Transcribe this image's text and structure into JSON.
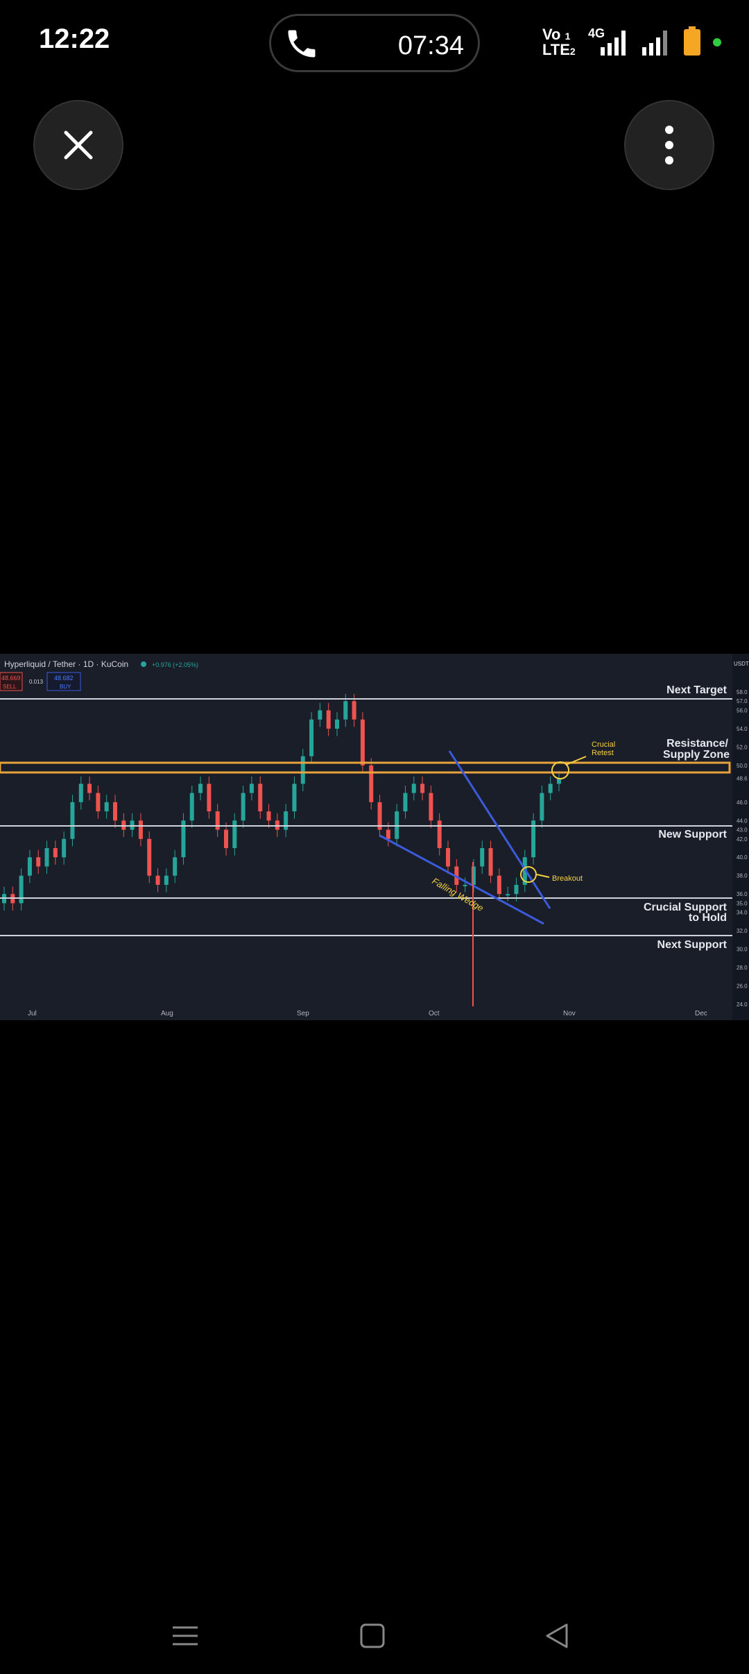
{
  "status_bar": {
    "time": "12:22",
    "call_timer": "07:34",
    "network_line1": "Vo",
    "network_line2": "LTE",
    "sim1": "1",
    "sim2": "2",
    "data_type": "4G"
  },
  "overlay": {
    "close_icon": "close-icon",
    "menu_icon": "more-vertical-icon"
  },
  "chart": {
    "header": "Hyperliquid / Tether · 1D · KuCoin",
    "change": "+0.976 (+2.05%)",
    "sell_price": "48.669",
    "sell_label": "SELL",
    "spread": "0.013",
    "buy_price": "48.682",
    "buy_label": "BUY",
    "currency": "USDT",
    "annotations": {
      "next_target": "Next Target",
      "resistance_line1": "Resistance/",
      "resistance_line2": "Supply Zone",
      "crucial_retest_line1": "Crucial",
      "crucial_retest_line2": "Retest",
      "new_support": "New Support",
      "breakout": "Breakout",
      "falling_wedge": "Falling Wedge",
      "crucial_support_line1": "Crucial Support",
      "crucial_support_line2": "to Hold",
      "next_support": "Next Support"
    },
    "x_labels": [
      "Jul",
      "Aug",
      "Sep",
      "Oct",
      "Nov",
      "Dec"
    ],
    "y_labels": [
      "58.0",
      "57.0",
      "56.0",
      "54.0",
      "52.0",
      "50.0",
      "48.6",
      "46.0",
      "44.0",
      "43.0",
      "42.0",
      "40.0",
      "38.0",
      "36.0",
      "35.0",
      "34.0",
      "32.0",
      "30.0",
      "28.0",
      "26.0",
      "24.0"
    ],
    "colors": {
      "bg": "#1a1e29",
      "up": "#26a69a",
      "down": "#ef5350",
      "zone": "#e8a33a",
      "wedge": "#3b5bdb",
      "annotation": "#f5d142"
    }
  },
  "chart_data": {
    "type": "candlestick",
    "title": "Hyperliquid / Tether · 1D · KuCoin",
    "xlabel": "",
    "ylabel": "",
    "x": [
      "Jul",
      "Aug",
      "Sep",
      "Oct",
      "Nov",
      "Dec"
    ],
    "ylim": [
      24,
      58
    ],
    "levels": [
      {
        "name": "Next Target",
        "value": 57.0
      },
      {
        "name": "Resistance/Supply Zone",
        "value": [
          48.6,
          49.6
        ]
      },
      {
        "name": "New Support",
        "value": 43.0
      },
      {
        "name": "Crucial Support to Hold",
        "value": 35.0
      },
      {
        "name": "Next Support",
        "value": 30.8
      }
    ],
    "close_series": [
      36,
      35,
      38,
      40,
      39,
      41,
      40,
      42,
      46,
      48,
      47,
      45,
      46,
      44,
      43,
      44,
      42,
      38,
      37,
      38,
      40,
      44,
      47,
      48,
      45,
      43,
      41,
      44,
      47,
      48,
      45,
      44,
      43,
      45,
      48,
      51,
      55,
      56,
      54,
      55,
      57,
      55,
      50,
      46,
      43,
      42,
      45,
      47,
      48,
      47,
      44,
      41,
      39,
      37,
      37,
      39,
      41,
      38,
      36,
      36,
      37,
      40,
      44,
      47,
      48,
      48.6
    ]
  },
  "nav_bar": {
    "menu_icon": "recents-icon",
    "home_icon": "home-icon",
    "back_icon": "back-icon"
  }
}
